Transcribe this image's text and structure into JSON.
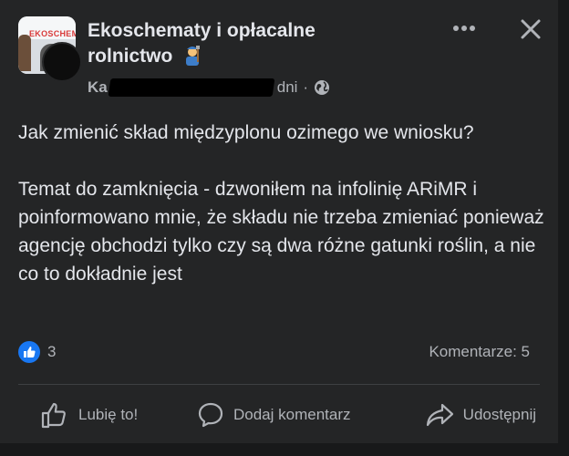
{
  "post": {
    "group_name": "Ekoschematy i opłacalne rolnictwo",
    "group_logo_text": "EKOSCHEM",
    "author_visible": "Ka",
    "time_suffix": "dni",
    "separator": "·",
    "privacy_icon": "globe-icon",
    "emoji_icon": "farmer-emoji-icon",
    "paragraphs": [
      "Jak zmienić skład międzyplonu ozimego we wniosku?",
      "Temat do zamknięcia - dzwoniłem na infolinię ARiMR i poinformowano mnie, że składu nie trzeba zmieniać ponieważ agencję obchodzi tylko czy są dwa różne gatunki roślin, a nie co to dokładnie jest"
    ],
    "reaction_count": "3",
    "comments_label": "Komentarze: 5"
  },
  "actions": {
    "like": "Lubię to!",
    "comment": "Dodaj komentarz",
    "share": "Udostępnij"
  },
  "colors": {
    "background": "#242526",
    "text_primary": "#e4e6eb",
    "text_secondary": "#b0b3b8",
    "like_blue": "#1877f2",
    "divider": "#3e4042"
  }
}
